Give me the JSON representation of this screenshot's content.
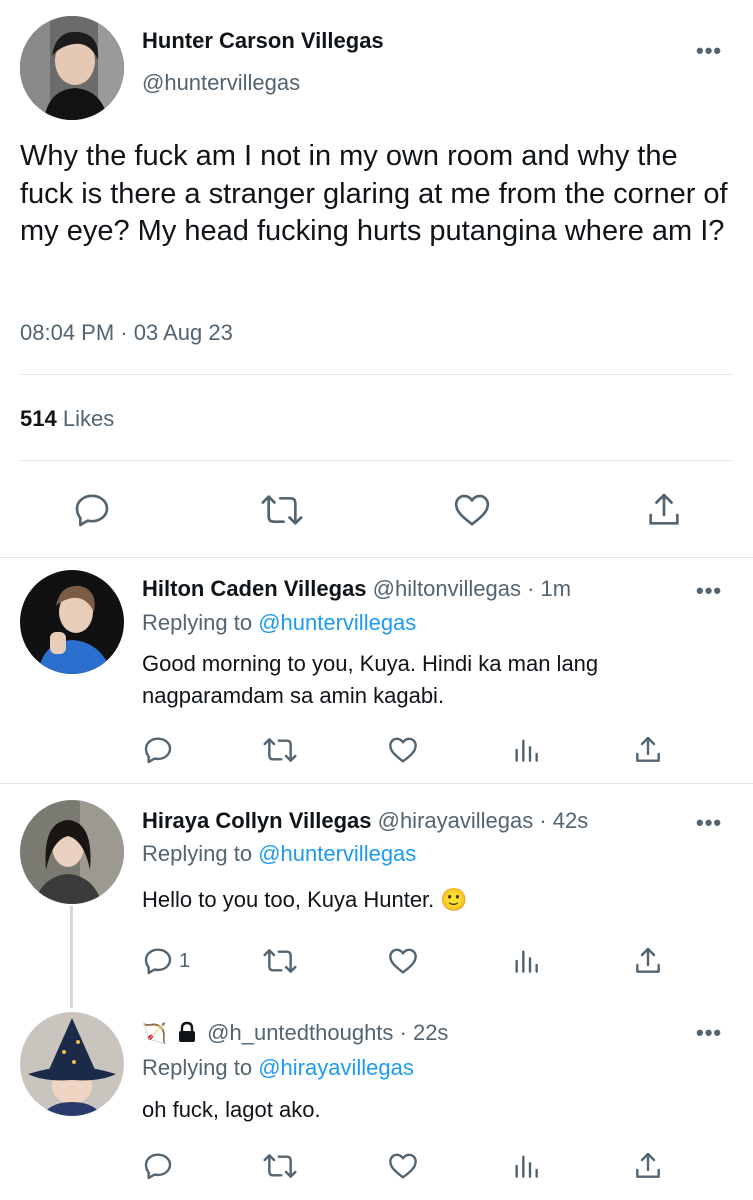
{
  "main_tweet": {
    "display_name": "Hunter Carson Villegas",
    "handle": "@huntervillegas",
    "text": "Why the fuck am I not in my own room and why the fuck is there a stranger glaring at me from the corner of my eye? My head fucking hurts putangina where am I?",
    "timestamp": "08:04 PM · 03 Aug 23",
    "likes_count": "514",
    "likes_label": "Likes"
  },
  "replies": [
    {
      "display_name": "Hilton Caden Villegas",
      "handle_time": "@hiltonvillegas · 1m",
      "replying_prefix": "Replying to",
      "replying_to": "@huntervillegas",
      "text": "Good morning to you, Kuya. Hindi ka man lang nagparamdam sa amin kagabi."
    },
    {
      "display_name": "Hiraya Collyn Villegas",
      "handle_time": "@hirayavillegas · 42s",
      "replying_prefix": "Replying to",
      "replying_to": "@huntervillegas",
      "text": "Hello to you too, Kuya Hunter. 🙂",
      "reply_count": "1"
    },
    {
      "display_name": "🏹",
      "handle_time": "@h_untedthoughts · 22s",
      "replying_prefix": "Replying to",
      "replying_to": "@hirayavillegas",
      "text": "oh fuck, lagot ako."
    }
  ],
  "more_label": "•••",
  "colors": {
    "link": "#1d9bf0",
    "secondary": "#536471",
    "text": "#0f1419",
    "divider": "#e1e4e8"
  }
}
